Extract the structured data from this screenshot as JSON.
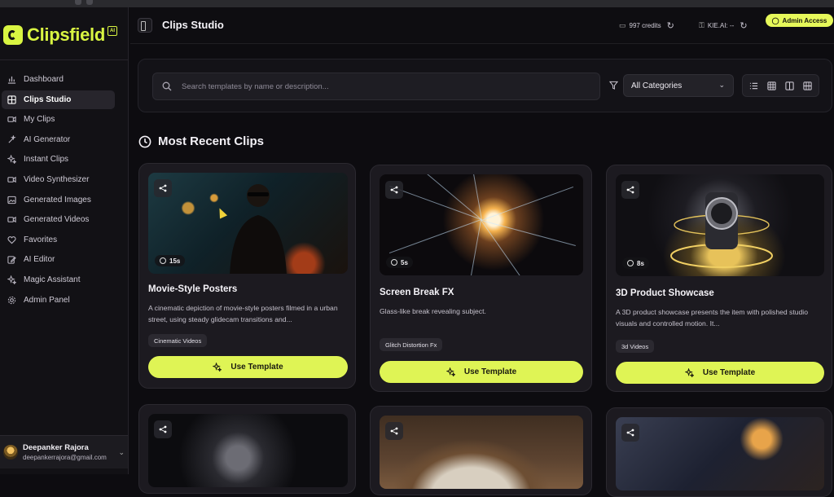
{
  "colors": {
    "accent": "#dff455",
    "background": "#0d0c10",
    "card": "#1c1a20"
  },
  "sidebar": {
    "logo_text": "Clipsfield",
    "logo_badge": "AI",
    "items": [
      {
        "label": "Dashboard",
        "icon": "bar-chart-icon",
        "active": false
      },
      {
        "label": "Clips Studio",
        "icon": "grid-icon",
        "active": true
      },
      {
        "label": "My Clips",
        "icon": "video-icon",
        "active": false
      },
      {
        "label": "AI Generator",
        "icon": "wand-icon",
        "active": false
      },
      {
        "label": "Instant Clips",
        "icon": "sparkle-icon",
        "active": false
      },
      {
        "label": "Video Synthesizer",
        "icon": "video-icon",
        "active": false
      },
      {
        "label": "Generated Images",
        "icon": "image-icon",
        "active": false
      },
      {
        "label": "Generated Videos",
        "icon": "video-icon",
        "active": false
      },
      {
        "label": "Favorites",
        "icon": "heart-icon",
        "active": false
      },
      {
        "label": "AI Editor",
        "icon": "edit-icon",
        "active": false
      },
      {
        "label": "Magic Assistant",
        "icon": "sparkle-icon",
        "active": false
      },
      {
        "label": "Admin Panel",
        "icon": "gear-icon",
        "active": false
      }
    ],
    "user": {
      "name": "Deepanker Rajora",
      "email": "deepankerrajora@gmail.com"
    }
  },
  "header": {
    "title": "Clips Studio",
    "credits": "997 credits",
    "kie": "KIE.AI: --",
    "admin_label": "Admin Access"
  },
  "filters": {
    "search_placeholder": "Search templates by name or description...",
    "category": "All Categories"
  },
  "section": {
    "title": "Most Recent Clips"
  },
  "cards": [
    {
      "title": "Movie-Style Posters",
      "desc": "A cinematic depiction of movie-style posters filmed in a urban street, using steady glidecam transitions and...",
      "tag": "Cinematic Videos",
      "duration": "15s",
      "button": "Use Template"
    },
    {
      "title": "Screen Break FX",
      "desc": "Glass-like break revealing subject.",
      "tag": "Glitch Distortion Fx",
      "duration": "5s",
      "button": "Use Template"
    },
    {
      "title": "3D Product Showcase",
      "desc": "A 3D product showcase presents the item with polished studio visuals and controlled motion. It...",
      "tag": "3d Videos",
      "duration": "8s",
      "button": "Use Template"
    }
  ]
}
